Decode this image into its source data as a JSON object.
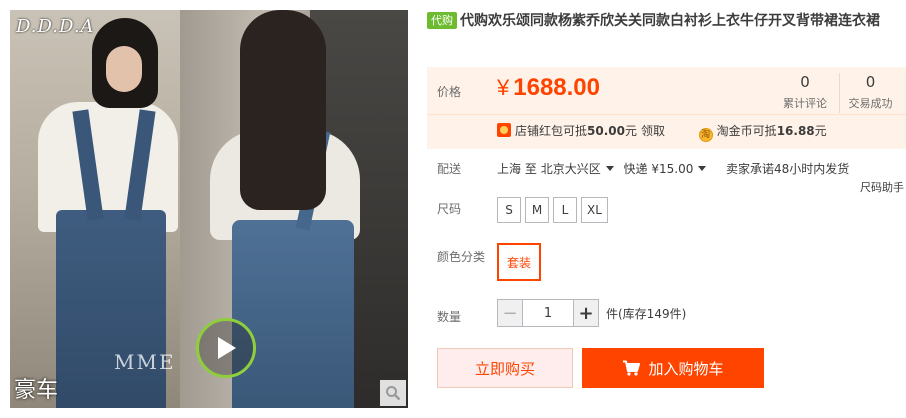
{
  "gallery": {
    "watermark_top": "D.D.D.A",
    "watermark_bottom": "豪车",
    "watermark_mid": "MME",
    "icons": [
      "play-icon",
      "magnifier-icon"
    ]
  },
  "product": {
    "badge": "代购",
    "title": "代购欢乐颂同款杨紫乔欣关关同款白衬衫上衣牛仔开叉背带裙连衣裙"
  },
  "price": {
    "label": "价格",
    "currency": "¥",
    "amount": "1688.00",
    "reviews_count": "0",
    "reviews_label": "累计评论",
    "sold_count": "0",
    "sold_label": "交易成功"
  },
  "promo": {
    "shop_coupon_prefix": "店铺红包可抵",
    "shop_coupon_amount": "50.00",
    "shop_coupon_suffix": "元",
    "shop_coupon_link": "领取",
    "coin_prefix": "淘金币可抵",
    "coin_amount": "16.88",
    "coin_suffix": "元",
    "coin_icon_text": "淘"
  },
  "delivery": {
    "label": "配送",
    "from": "上海",
    "to_word": "至",
    "destination": "北京大兴区",
    "shipping": "快递 ¥15.00",
    "promise": "卖家承诺48小时内发货"
  },
  "size": {
    "label": "尺码",
    "helper": "尺码助手",
    "options": [
      "S",
      "M",
      "L",
      "XL"
    ]
  },
  "color": {
    "label": "颜色分类",
    "selected": "套装"
  },
  "quantity": {
    "label": "数量",
    "value": "1",
    "minus": "−",
    "plus": "+",
    "stock": "件(库存149件)"
  },
  "actions": {
    "buy_now": "立即购买",
    "add_cart": "加入购物车"
  },
  "colors": {
    "accent": "#ff4400",
    "badge_green": "#6dbb2f",
    "price_bg": "#fff2e8"
  }
}
